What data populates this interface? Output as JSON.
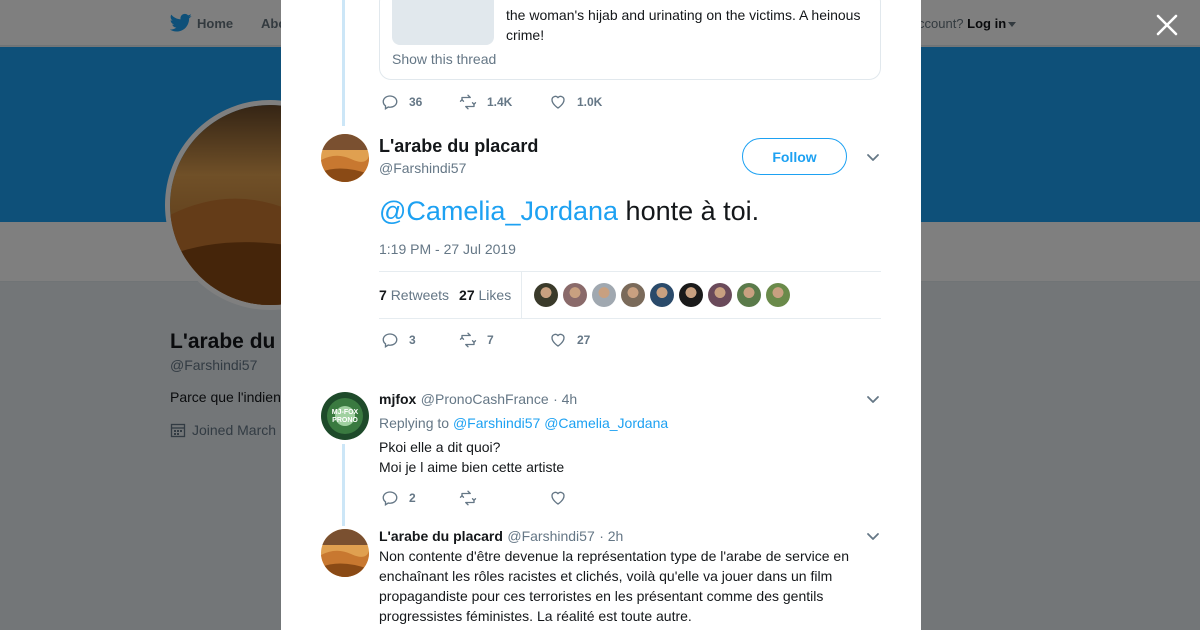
{
  "topbar": {
    "home_label": "Home",
    "about_label": "Abo",
    "account_prompt": "ccount?",
    "login_label": "Log in"
  },
  "profile_bg": {
    "name": "L'arabe du",
    "handle": "@Farshindi57",
    "bio": "Parce que l'indien",
    "joined": "Joined March"
  },
  "quoted_tweet": {
    "text_line1": "the woman's hijab and urinating on the victims. A heinous",
    "text_line2": "crime!",
    "show_thread": "Show this thread",
    "replies": "36",
    "retweets": "1.4K",
    "likes": "1.0K"
  },
  "main_tweet": {
    "name": "L'arabe du placard",
    "handle": "@Farshindi57",
    "follow_label": "Follow",
    "mention": "@Camelia_Jordana",
    "text": " honte à toi.",
    "timestamp": "1:19 PM - 27 Jul 2019",
    "retweet_count": "7",
    "retweet_label": "Retweets",
    "like_count": "27",
    "like_label": "Likes",
    "replies": "3",
    "retweets": "7",
    "likes": "27",
    "liker_colors": [
      "#3a3a2a",
      "#8a6a6a",
      "#a0a8b0",
      "#7a6a5a",
      "#2a4a6a",
      "#1a1a1a",
      "#6a4a5a",
      "#5a7a4a",
      "#6a8a4a"
    ]
  },
  "reply1": {
    "name": "mjfox",
    "handle": "@PronoCashFrance",
    "time": "· 4h",
    "replying_to_label": "Replying to",
    "mention1": "@Farshindi57",
    "mention2": "@Camelia_Jordana",
    "line1": "Pkoi elle a dit quoi?",
    "line2": "Moi je l aime bien cette artiste",
    "replies": "2",
    "avatar_text": "MJ-FOX PRONO"
  },
  "reply2": {
    "name": "L'arabe du placard",
    "handle": "@Farshindi57",
    "time": "· 2h",
    "line1": "Non contente d'être devenue la représentation type de l'arabe de service en",
    "line2": "enchaînant les rôles racistes et clichés, voilà qu'elle va jouer dans un film",
    "line3": "propagandiste pour ces terroristes en les présentant comme des gentils",
    "line4": "progressistes féministes. La réalité est toute autre."
  },
  "colors": {
    "accent": "#1da1f2",
    "thread_line": "#cce6f7",
    "muted": "#657786"
  }
}
